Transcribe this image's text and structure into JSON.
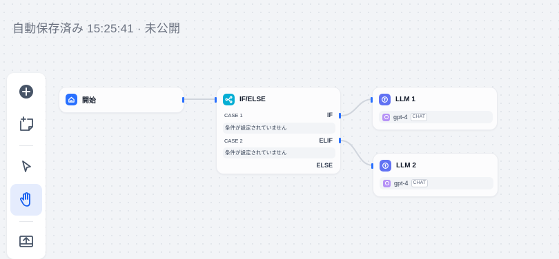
{
  "header": {
    "status": "自動保存済み 15:25:41 · 未公開"
  },
  "toolbar": {
    "tools": [
      {
        "name": "add-node",
        "icon": "plus-circle-icon"
      },
      {
        "name": "add-note",
        "icon": "sticky-note-icon"
      },
      {
        "name": "pointer",
        "icon": "cursor-icon"
      },
      {
        "name": "hand",
        "icon": "hand-icon",
        "active": true
      },
      {
        "name": "export",
        "icon": "image-export-icon"
      }
    ]
  },
  "nodes": {
    "start": {
      "title": "開始",
      "icon": "home-icon",
      "color": "#2970ff"
    },
    "ifelse": {
      "title": "IF/ELSE",
      "icon": "branch-icon",
      "color": "#06aed4",
      "cases": [
        {
          "label": "CASE 1",
          "tag": "IF",
          "condition": "条件が設定されていません"
        },
        {
          "label": "CASE 2",
          "tag": "ELIF",
          "condition": "条件が設定されていません"
        }
      ],
      "else_label": "ELSE"
    },
    "llm1": {
      "title": "LLM 1",
      "icon": "brain-icon",
      "color": "#6172f3",
      "model": "gpt-4",
      "mode": "CHAT"
    },
    "llm2": {
      "title": "LLM 2",
      "icon": "brain-icon",
      "color": "#6172f3",
      "model": "gpt-4",
      "mode": "CHAT"
    }
  },
  "colors": {
    "accent": "#2970ff",
    "edge": "#d0d5dd",
    "active_tool": "#e5ecfd"
  }
}
